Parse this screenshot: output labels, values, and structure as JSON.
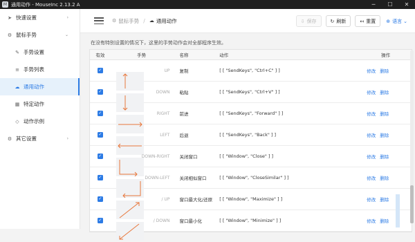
{
  "window": {
    "title": "通用动作 - MouseInc 2.13.2 A",
    "app_icon": "M",
    "minimize": "─",
    "maximize": "☐",
    "close": "✕"
  },
  "sidebar": {
    "items": [
      {
        "label": "快速设置",
        "icon": "send-icon",
        "glyph": "➤",
        "arrow": "›"
      },
      {
        "label": "鼠标手势",
        "icon": "gear-icon",
        "glyph": "⚙",
        "arrow": "⌄"
      },
      {
        "label": "手势设置",
        "icon": "brush-icon",
        "glyph": "✎"
      },
      {
        "label": "手势列表",
        "icon": "list-icon",
        "glyph": "≡"
      },
      {
        "label": "通用动作",
        "icon": "cloud-icon",
        "glyph": "☁"
      },
      {
        "label": "特定动作",
        "icon": "calendar-icon",
        "glyph": "▦"
      },
      {
        "label": "动作示例",
        "icon": "diamond-icon",
        "glyph": "◇"
      },
      {
        "label": "其它设置",
        "icon": "gear-icon",
        "glyph": "⚙",
        "arrow": "›"
      }
    ]
  },
  "header": {
    "breadcrumb": [
      {
        "label": "鼠标手势",
        "glyph": "⚙"
      },
      {
        "label": "通用动作",
        "glyph": "☁"
      }
    ],
    "separator": "/",
    "buttons": {
      "save": "保存",
      "refresh": "刷新",
      "reset": "重置",
      "language": "语言"
    },
    "glyphs": {
      "save": "⇩",
      "refresh": "↻",
      "reset": "↤",
      "language": "⊕",
      "caret": "⌄"
    }
  },
  "main": {
    "hint": "在没有特别设置的情况下，这里的手势动作会对全部程序生效。",
    "columns": {
      "enabled": "有效",
      "gesture": "手势",
      "name": "名称",
      "action": "动作",
      "ops": "操作"
    },
    "rows": [
      {
        "enabled": true,
        "gesture": "UP",
        "name": "复制",
        "action": "[ [ \"SendKeys\", \"Ctrl+C\" ] ]",
        "edit": "修改",
        "delete": "删除"
      },
      {
        "enabled": true,
        "gesture": "DOWN",
        "name": "粘贴",
        "action": "[ [ \"SendKeys\", \"Ctrl+V\" ] ]",
        "edit": "修改",
        "delete": "删除"
      },
      {
        "enabled": true,
        "gesture": "RIGHT",
        "name": "前进",
        "action": "[ [ \"SendKeys\", \"Forward\" ] ]",
        "edit": "修改",
        "delete": "删除"
      },
      {
        "enabled": true,
        "gesture": "LEFT",
        "name": "后退",
        "action": "[ [ \"SendKeys\", \"Back\" ] ]",
        "edit": "修改",
        "delete": "删除"
      },
      {
        "enabled": true,
        "gesture": "DOWN-RIGHT",
        "name": "关闭窗口",
        "action": "[ [ \"Window\", \"Close\" ] ]",
        "edit": "修改",
        "delete": "删除"
      },
      {
        "enabled": true,
        "gesture": "DOWN-LEFT",
        "name": "关闭相似窗口",
        "action": "[ [ \"Window\", \"CloseSimilar\" ] ]",
        "edit": "修改",
        "delete": "删除"
      },
      {
        "enabled": true,
        "gesture": "/ UP",
        "name": "窗口最大化/还原",
        "action": "[ [ \"Window\", \"Maximize\" ] ]",
        "edit": "修改",
        "delete": "删除"
      },
      {
        "enabled": true,
        "gesture": "/ DOWN",
        "name": "窗口最小化",
        "action": "[ [ \"Window\", \"Minimize\" ] ]",
        "edit": "修改",
        "delete": "删除"
      }
    ]
  },
  "colors": {
    "accent": "#2c7be5",
    "gesture_line": "#e8763a"
  }
}
